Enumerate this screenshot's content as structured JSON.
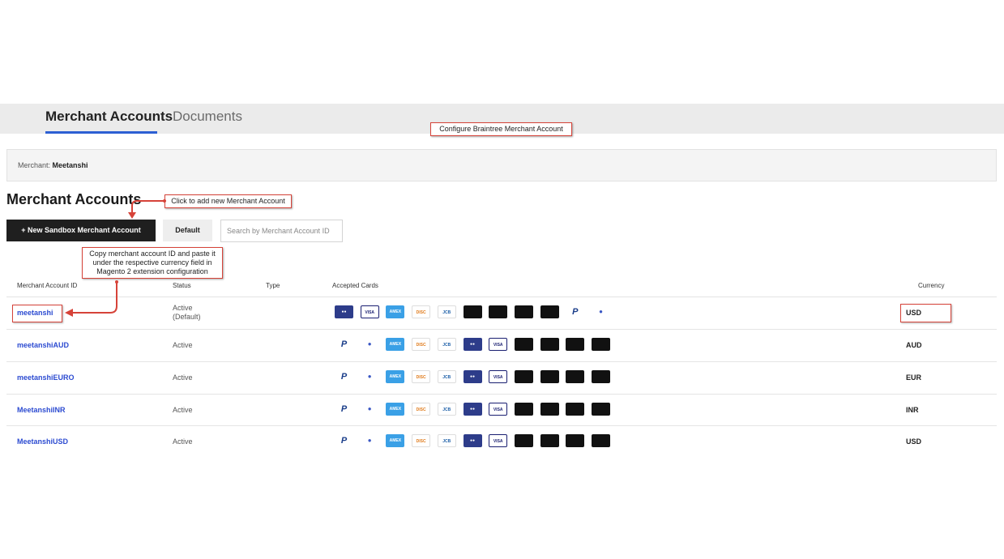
{
  "tabs": {
    "merchant": "Merchant Accounts",
    "documents": "Documents"
  },
  "annotations": {
    "configure": "Configure Braintree Merchant Account",
    "click_add": "Click to add new Merchant Account",
    "copy_id": "Copy merchant account ID and paste it under the respective currency field in Magento 2 extension configuration"
  },
  "merchant_bar": {
    "label": "Merchant: ",
    "name": "Meetanshi"
  },
  "section_title": "Merchant Accounts",
  "buttons": {
    "new_account": "+ New Sandbox Merchant Account",
    "default": "Default"
  },
  "search": {
    "placeholder": "Search by Merchant Account ID"
  },
  "table": {
    "headers": {
      "id": "Merchant Account ID",
      "status": "Status",
      "type": "Type",
      "cards": "Accepted Cards",
      "currency": "Currency"
    },
    "rows": [
      {
        "id": "meetanshi",
        "status": "Active",
        "status2": "(Default)",
        "currency": "USD"
      },
      {
        "id": "meetanshiAUD",
        "status": "Active",
        "status2": "",
        "currency": "AUD"
      },
      {
        "id": "meetanshiEURO",
        "status": "Active",
        "status2": "",
        "currency": "EUR"
      },
      {
        "id": "MeetanshiINR",
        "status": "Active",
        "status2": "",
        "currency": "INR"
      },
      {
        "id": "MeetanshiUSD",
        "status": "Active",
        "status2": "",
        "currency": "USD"
      }
    ]
  },
  "card_icons": {
    "first_row": [
      "mastercard-icon",
      "visa-icon",
      "amex-icon",
      "discover-icon",
      "jcb-icon",
      "apple-pay-visa-icon",
      "apple-pay-mc-icon",
      "apple-pay-amex-icon",
      "apple-pay-discover-icon",
      "paypal-icon",
      "local-payment-icon"
    ],
    "other_rows": [
      "paypal-icon",
      "local-payment-icon",
      "amex-icon",
      "discover-icon",
      "jcb-icon",
      "mastercard-icon",
      "visa-icon",
      "apple-pay-visa-icon",
      "apple-pay-mc-icon",
      "apple-pay-amex-icon",
      "apple-pay-discover-icon"
    ]
  },
  "colors": {
    "accent": "#2c5fd3",
    "link": "#2c4bd1",
    "annotation_border": "#d64339",
    "button_dark": "#1f1f1f"
  }
}
